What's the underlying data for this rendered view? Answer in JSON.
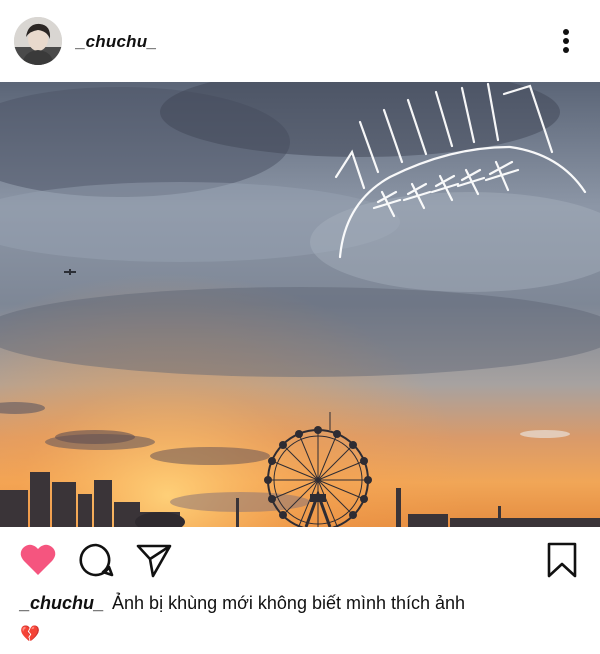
{
  "post": {
    "username": "_chuchu_",
    "caption_username": "_chuchu_",
    "caption_text": "Ảnh bị khùng mới không biết mình thích ảnh",
    "caption_emoji": "💔"
  },
  "icons": {
    "more": "more-vertical-icon",
    "like": "heart-filled-icon",
    "comment": "comment-bubble-icon",
    "share": "send-paper-plane-icon",
    "save": "bookmark-icon"
  },
  "colors": {
    "like_active": "#f5557f",
    "text": "#111111"
  }
}
